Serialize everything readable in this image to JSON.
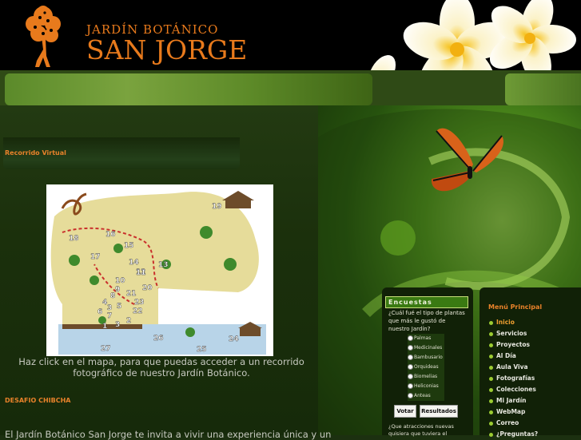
{
  "header": {
    "logo_line1": "JARDÍN  BOTÁNICO",
    "logo_line2": "SAN JORGE",
    "logo_icon": "tree-logo-icon"
  },
  "main": {
    "section1_title": "Recorrido Virtual",
    "map_caption": "Haz click en el mapa, para que puedas acceder a un recorrido fotográfico de nuestro Jardín Botánico.",
    "map_numbers": [
      "19",
      "16",
      "15",
      "18",
      "17",
      "14",
      "13",
      "12",
      "10",
      "20",
      "9",
      "21",
      "8",
      "23",
      "4",
      "5",
      "3",
      "22",
      "6",
      "7",
      "1",
      "2",
      "3",
      "26",
      "27",
      "25",
      "24",
      "11"
    ],
    "section2_title": "DESAFIO CHIBCHA",
    "section2_text": "El Jardín Botánico San Jorge te invita a vivir una experiencia única y un"
  },
  "poll": {
    "title": "Encuestas",
    "question": "¿Cuál fué el tipo de plantas que más le gustó de nuestro Jardín?",
    "options": [
      "Palmas",
      "Medicinales",
      "Bambusario",
      "Orquideas",
      "Biomelias",
      "Heliconias",
      "Anteas"
    ],
    "vote_label": "Votar",
    "results_label": "Resultados",
    "question2": "¿Que atracciones nuevas quisiera que tuviera el"
  },
  "menu": {
    "title": "Menú Principal",
    "items": [
      "Inicio",
      "Servicios",
      "Proyectos",
      "Al Día",
      "Aula Viva",
      "Fotografías",
      "Colecciones",
      "Mi Jardín",
      "WebMap",
      "Correo",
      "¿Preguntas?"
    ],
    "active_index": 0
  },
  "colors": {
    "accent_orange": "#e8822a",
    "menu_bullet": "#9ccc32",
    "poll_header": "#3a7a12"
  }
}
